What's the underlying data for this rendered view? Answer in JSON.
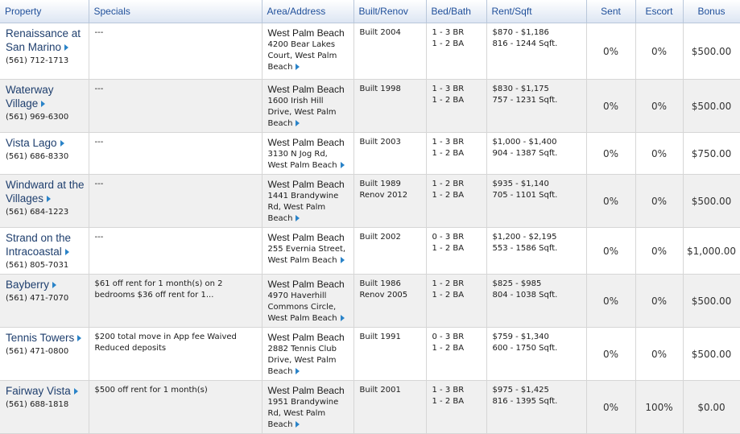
{
  "columns": {
    "property": "Property",
    "specials": "Specials",
    "area": "Area/Address",
    "built": "Built/Renov",
    "bedbath": "Bed/Bath",
    "rent": "Rent/Sqft",
    "sent": "Sent",
    "escort": "Escort",
    "bonus": "Bonus"
  },
  "rows": [
    {
      "name": "Renaissance at San Marino",
      "phone": "(561) 712-1713",
      "specials": "---",
      "city": "West Palm Beach",
      "address": "4200 Bear Lakes Court, West Palm Beach",
      "built": "Built 2004",
      "renov": "",
      "bed": "1 - 3 BR",
      "bath": "1 - 2 BA",
      "rent": "$870 - $1,186",
      "sqft": "816 - 1244 Sqft.",
      "sent": "0%",
      "escort": "0%",
      "bonus": "$500.00"
    },
    {
      "name": "Waterway Village",
      "phone": "(561) 969-6300",
      "specials": "---",
      "city": "West Palm Beach",
      "address": "1600 Irish Hill Drive, West Palm Beach",
      "built": "Built 1998",
      "renov": "",
      "bed": "1 - 3 BR",
      "bath": "1 - 2 BA",
      "rent": "$830 - $1,175",
      "sqft": "757 - 1231 Sqft.",
      "sent": "0%",
      "escort": "0%",
      "bonus": "$500.00"
    },
    {
      "name": "Vista Lago",
      "phone": "(561) 686-8330",
      "specials": "---",
      "city": "West Palm Beach",
      "address": "3130 N Jog Rd, West Palm Beach",
      "built": "Built 2003",
      "renov": "",
      "bed": "1 - 3 BR",
      "bath": "1 - 2 BA",
      "rent": "$1,000 - $1,400",
      "sqft": "904 - 1387 Sqft.",
      "sent": "0%",
      "escort": "0%",
      "bonus": "$750.00"
    },
    {
      "name": "Windward at the Villages",
      "phone": "(561) 684-1223",
      "specials": "---",
      "city": "West Palm Beach",
      "address": "1441 Brandywine Rd, West Palm Beach",
      "built": "Built 1989",
      "renov": "Renov 2012",
      "bed": "1 - 2 BR",
      "bath": "1 - 2 BA",
      "rent": "$935 - $1,140",
      "sqft": "705 - 1101 Sqft.",
      "sent": "0%",
      "escort": "0%",
      "bonus": "$500.00"
    },
    {
      "name": "Strand on the Intracoastal",
      "phone": "(561) 805-7031",
      "specials": "---",
      "city": "West Palm Beach",
      "address": "255 Evernia Street, West Palm Beach",
      "built": "Built 2002",
      "renov": "",
      "bed": "0 - 3 BR",
      "bath": "1 - 2 BA",
      "rent": "$1,200 - $2,195",
      "sqft": "553 - 1586 Sqft.",
      "sent": "0%",
      "escort": "0%",
      "bonus": "$1,000.00"
    },
    {
      "name": "Bayberry",
      "phone": "(561) 471-7070",
      "specials": "$61 off rent for 1 month(s) on 2 bedrooms $36 off rent for 1...",
      "city": "West Palm Beach",
      "address": "4970 Haverhill Commons Circle, West Palm Beach",
      "built": "Built 1986",
      "renov": "Renov 2005",
      "bed": "1 - 2 BR",
      "bath": "1 - 2 BA",
      "rent": "$825 - $985",
      "sqft": "804 - 1038 Sqft.",
      "sent": "0%",
      "escort": "0%",
      "bonus": "$500.00"
    },
    {
      "name": "Tennis Towers",
      "phone": "(561) 471-0800",
      "specials": "$200 total move in App fee Waived Reduced deposits",
      "city": "West Palm Beach",
      "address": "2882 Tennis Club Drive, West Palm Beach",
      "built": "Built 1991",
      "renov": "",
      "bed": "0 - 3 BR",
      "bath": "1 - 2 BA",
      "rent": "$759 - $1,340",
      "sqft": "600 - 1750 Sqft.",
      "sent": "0%",
      "escort": "0%",
      "bonus": "$500.00"
    },
    {
      "name": "Fairway Vista",
      "phone": "(561) 688-1818",
      "specials": "$500 off rent for 1 month(s)",
      "city": "West Palm Beach",
      "address": "1951 Brandywine Rd, West Palm Beach",
      "built": "Built 2001",
      "renov": "",
      "bed": "1 - 3 BR",
      "bath": "1 - 2 BA",
      "rent": "$975 - $1,425",
      "sqft": "816 - 1395 Sqft.",
      "sent": "0%",
      "escort": "100%",
      "bonus": "$0.00"
    }
  ]
}
